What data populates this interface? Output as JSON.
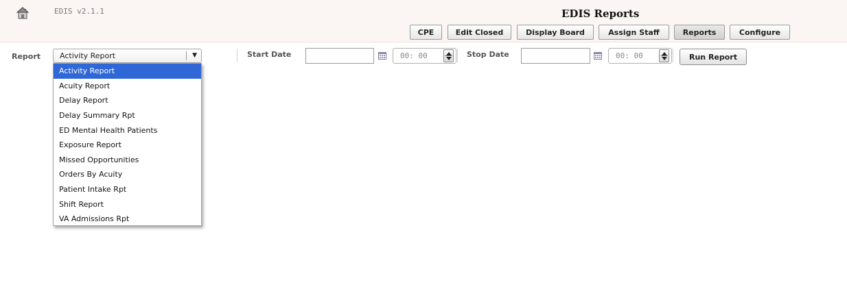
{
  "header": {
    "version": "EDIS v2.1.1",
    "title": "EDIS Reports",
    "home_icon": "home-icon"
  },
  "nav": [
    {
      "label": "CPE",
      "active": false
    },
    {
      "label": "Edit Closed",
      "active": false
    },
    {
      "label": "Display Board",
      "active": false
    },
    {
      "label": "Assign Staff",
      "active": false
    },
    {
      "label": "Reports",
      "active": true
    },
    {
      "label": "Configure",
      "active": false
    }
  ],
  "form": {
    "report_label": "Report",
    "report_selected": "Activity Report",
    "report_arrow": "▼",
    "start_label": "Start Date",
    "start_date_value": "",
    "start_time": "00: 00",
    "stop_label": "Stop Date",
    "stop_date_value": "",
    "stop_time": "00: 00",
    "run_label": "Run Report"
  },
  "dropdown": {
    "options": [
      "Activity Report",
      "Acuity Report",
      "Delay Report",
      "Delay Summary Rpt",
      "ED Mental Health Patients",
      "Exposure Report",
      "Missed Opportunities",
      "Orders By Acuity",
      "Patient Intake Rpt",
      "Shift Report",
      "VA Admissions Rpt"
    ],
    "selected_index": 0,
    "selected_color": "#3067d6"
  }
}
